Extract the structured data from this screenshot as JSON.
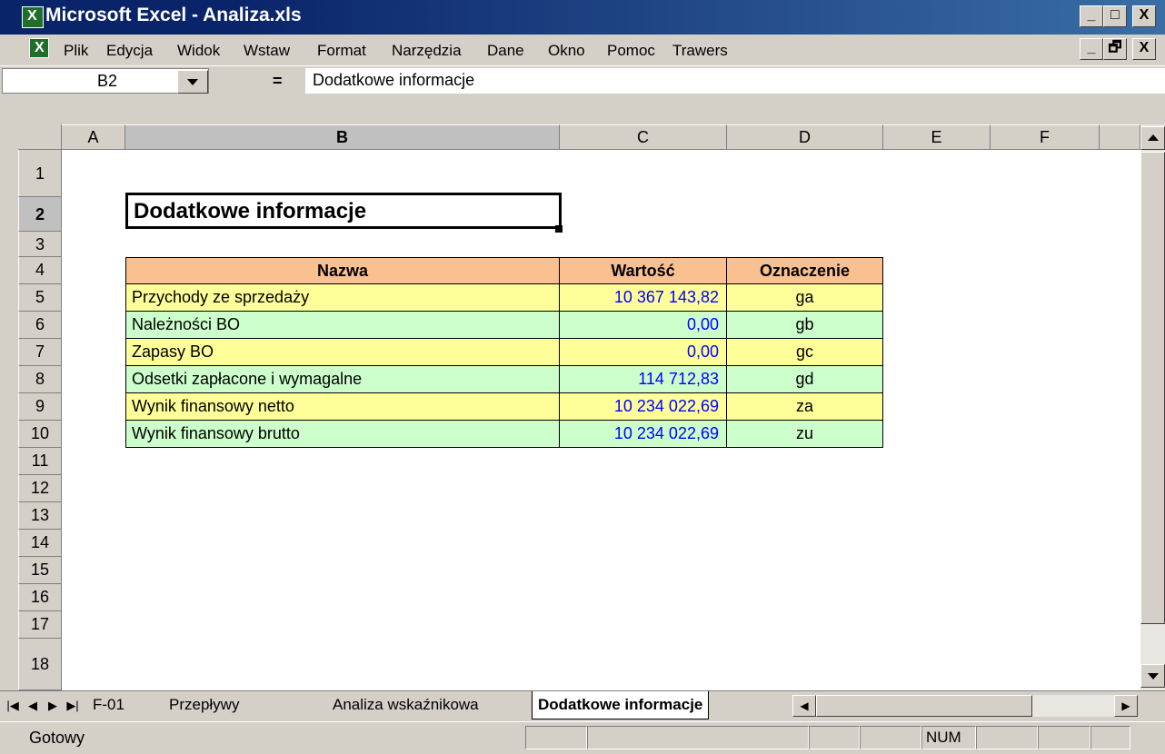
{
  "window": {
    "title": "Microsoft Excel - Analiza.xls",
    "min": "_",
    "max": "□",
    "close": "X",
    "doc_min": "_",
    "doc_restore": "🗗",
    "doc_close": "X"
  },
  "menu": [
    "Plik",
    "Edycja",
    "Widok",
    "Wstaw",
    "Format",
    "Narzędzia",
    "Dane",
    "Okno",
    "Pomoc",
    "Trawers"
  ],
  "formula_bar": {
    "cell_ref": "B2",
    "equals": "=",
    "content": "Dodatkowe informacje"
  },
  "columns": [
    "A",
    "B",
    "C",
    "D",
    "E",
    "F"
  ],
  "rows": [
    "1",
    "2",
    "3",
    "4",
    "5",
    "6",
    "7",
    "8",
    "9",
    "10",
    "11",
    "12",
    "13",
    "14",
    "15",
    "16",
    "17",
    "18"
  ],
  "sheet": {
    "title": "Dodatkowe informacje",
    "headers": {
      "name": "Nazwa",
      "value": "Wartość",
      "code": "Oznaczenie"
    },
    "rows": [
      {
        "name": "Przychody ze sprzedaży",
        "value": "10 367 143,82",
        "code": "ga",
        "color": "#ffff99"
      },
      {
        "name": "Należności BO",
        "value": "0,00",
        "code": "gb",
        "color": "#ccffcc"
      },
      {
        "name": "Zapasy BO",
        "value": "0,00",
        "code": "gc",
        "color": "#ffff99"
      },
      {
        "name": "Odsetki zapłacone i wymagalne",
        "value": "114 712,83",
        "code": "gd",
        "color": "#ccffcc"
      },
      {
        "name": "Wynik finansowy netto",
        "value": "10 234 022,69",
        "code": "za",
        "color": "#ffff99"
      },
      {
        "name": "Wynik finansowy brutto",
        "value": "10 234 022,69",
        "code": "zu",
        "color": "#ccffcc"
      }
    ],
    "header_color": "#fac090",
    "value_color": "#0000ff"
  },
  "tabs": [
    "F-01",
    "Przepływy",
    "Analiza wskaźnikowa",
    "Dodatkowe informacje"
  ],
  "active_tab": "Dodatkowe informacje",
  "status": {
    "ready": "Gotowy",
    "num": "NUM"
  }
}
